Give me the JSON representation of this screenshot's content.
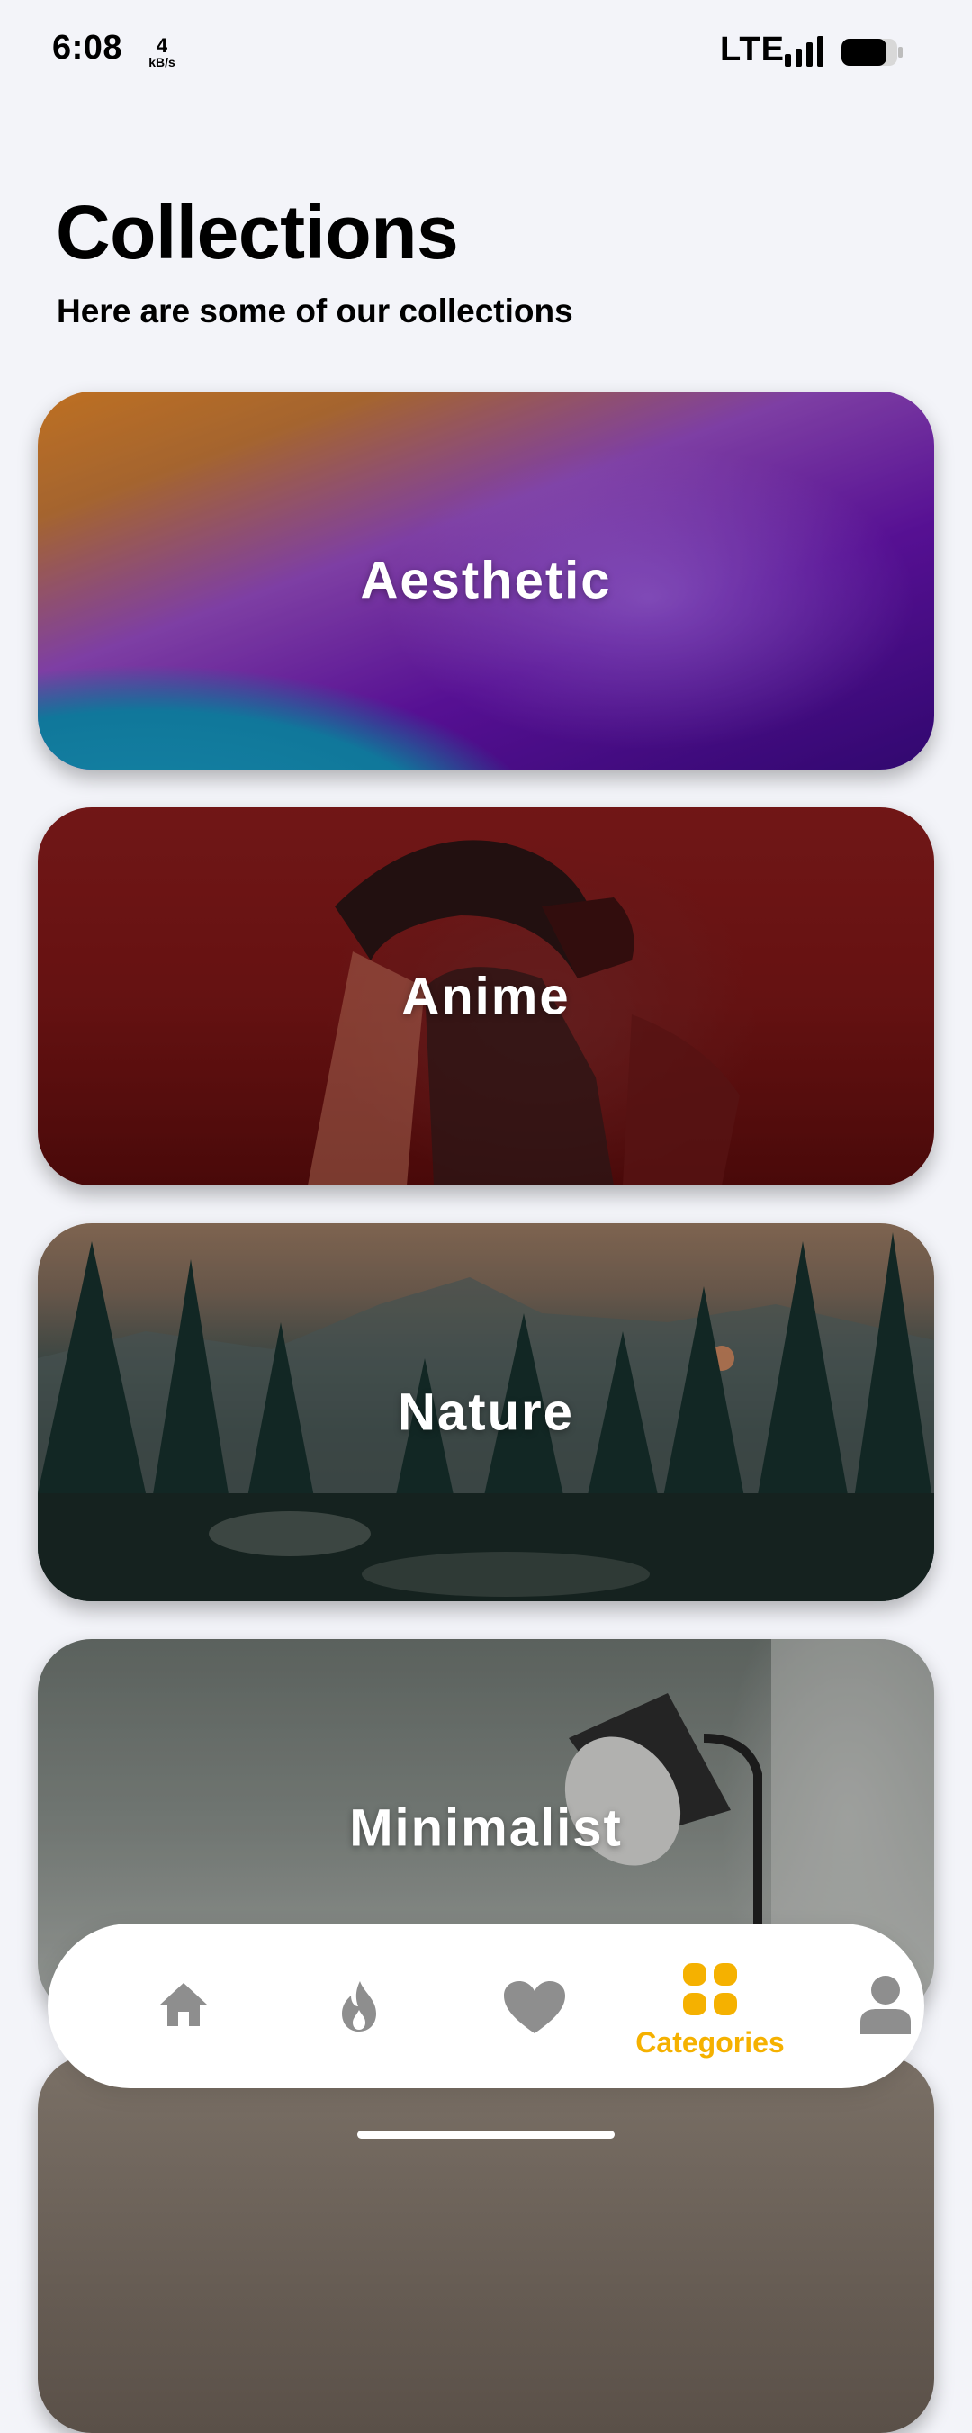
{
  "status_bar": {
    "time": "6:08",
    "speed_value": "4",
    "speed_unit": "kB/s",
    "network": "LTE"
  },
  "header": {
    "title": "Collections",
    "subtitle": "Here are some of our collections"
  },
  "collections": [
    {
      "label": "Aesthetic"
    },
    {
      "label": "Anime"
    },
    {
      "label": "Nature"
    },
    {
      "label": "Minimalist"
    }
  ],
  "bottom_nav": {
    "items": [
      {
        "icon": "home-icon",
        "label": ""
      },
      {
        "icon": "fire-icon",
        "label": ""
      },
      {
        "icon": "heart-icon",
        "label": ""
      },
      {
        "icon": "grid-icon",
        "label": "Categories",
        "active": true
      },
      {
        "icon": "user-icon",
        "label": ""
      }
    ],
    "active_color": "#f5b100",
    "inactive_color": "#8e8e8e"
  }
}
